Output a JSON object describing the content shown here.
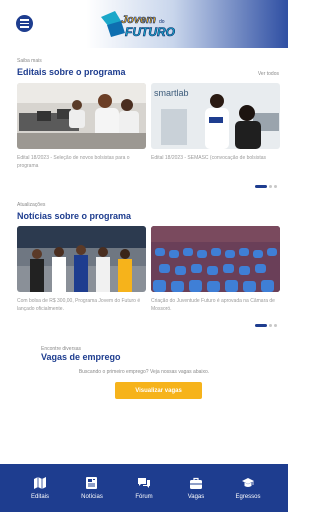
{
  "header": {
    "logo_text": "Jovem do Futuro",
    "logo_word_top": "Jovem",
    "logo_word_small": "do",
    "logo_word_bottom": "FUTURO"
  },
  "editais": {
    "small_label": "Saiba mais",
    "title": "Editais sobre o programa",
    "see_all": "Ver todos",
    "cards": [
      {
        "caption": "Edital 18/2023 - Seleção de novos bolsistas para o programa"
      },
      {
        "caption": "Edital 18/2023 - SEMASC (convocação de bolsistas"
      }
    ]
  },
  "noticias": {
    "small_label": "Atualizações",
    "title": "Notícias sobre o programa",
    "cards": [
      {
        "caption": "Com bolsa de R$ 300,00, Programa Jovem do Futuro é lançado oficialmente."
      },
      {
        "caption": "Criação do Juventude Futuro é aprovada na Câmara de Mossoró."
      }
    ]
  },
  "vagas": {
    "small_label": "Encontre diversas",
    "title": "Vagas de emprego",
    "description": "Buscando o primeiro emprego? Veja nossas vagas abaixo.",
    "button": "Visualizar vagas"
  },
  "bottom_nav": [
    {
      "label": "Editais",
      "icon": "map-icon"
    },
    {
      "label": "Notícias",
      "icon": "newspaper-icon"
    },
    {
      "label": "Fórum",
      "icon": "chat-icon"
    },
    {
      "label": "Vagas",
      "icon": "briefcase-icon"
    },
    {
      "label": "Egressos",
      "icon": "graduation-cap-icon"
    }
  ],
  "colors": {
    "primary": "#1e3d8f",
    "accent": "#f6b31b"
  }
}
